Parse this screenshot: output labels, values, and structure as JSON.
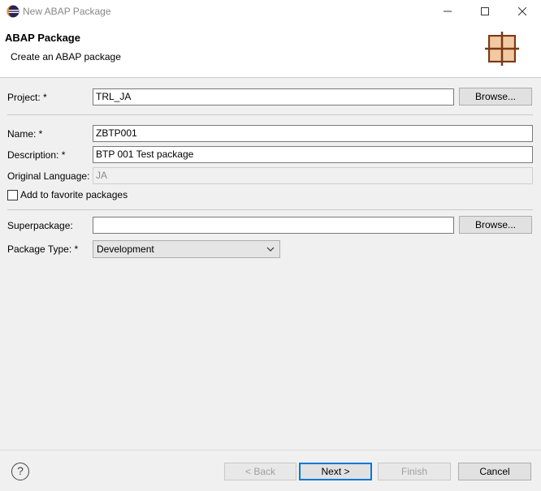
{
  "window": {
    "title": "New ABAP Package",
    "controls": {
      "minimize": "minimize-icon",
      "maximize": "maximize-icon",
      "close": "close-icon"
    }
  },
  "banner": {
    "title": "ABAP Package",
    "subtitle": "Create an ABAP package"
  },
  "form": {
    "project": {
      "label": "Project: *",
      "value": "TRL_JA",
      "browse": "Browse..."
    },
    "name": {
      "label": "Name: *",
      "value": "ZBTP001"
    },
    "description": {
      "label": "Description: *",
      "value": "BTP 001 Test package"
    },
    "original_language": {
      "label": "Original Language:",
      "value": "JA"
    },
    "favorite": {
      "label": "Add to favorite packages",
      "checked": false
    },
    "superpackage": {
      "label": "Superpackage:",
      "value": "",
      "browse": "Browse..."
    },
    "package_type": {
      "label": "Package Type: *",
      "selected": "Development"
    }
  },
  "footer": {
    "help": "?",
    "back": "< Back",
    "next": "Next >",
    "finish": "Finish",
    "cancel": "Cancel"
  },
  "colors": {
    "accent": "#0078d7",
    "disabled_text": "#a0a0a0"
  }
}
